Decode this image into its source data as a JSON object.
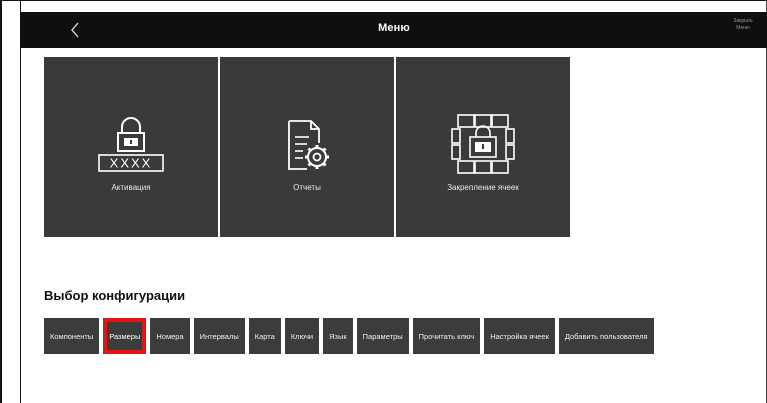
{
  "header": {
    "title": "Меню",
    "close_label": "Закрыть Меню"
  },
  "tiles": [
    {
      "label": "Активация",
      "icon": "lock-key-icon"
    },
    {
      "label": "Отчеты",
      "icon": "report-gear-icon"
    },
    {
      "label": "Закрепление ячеек",
      "icon": "cell-lock-icon"
    }
  ],
  "config": {
    "title": "Выбор конфигурации",
    "buttons": [
      {
        "label": "Компоненты"
      },
      {
        "label": "Размеры",
        "highlighted": true
      },
      {
        "label": "Номера"
      },
      {
        "label": "Интервалы"
      },
      {
        "label": "Карта"
      },
      {
        "label": "Ключи"
      },
      {
        "label": "Язык"
      },
      {
        "label": "Параметры"
      },
      {
        "label": "Прочитать ключ"
      },
      {
        "label": "Настройка ячеек"
      },
      {
        "label": "Добавить пользователя"
      }
    ]
  },
  "activation_code": "XXXX",
  "colors": {
    "topbar": "#0f0f0f",
    "tile": "#3a3a3a",
    "button": "#3c3c3c",
    "highlight": "#e01515"
  }
}
